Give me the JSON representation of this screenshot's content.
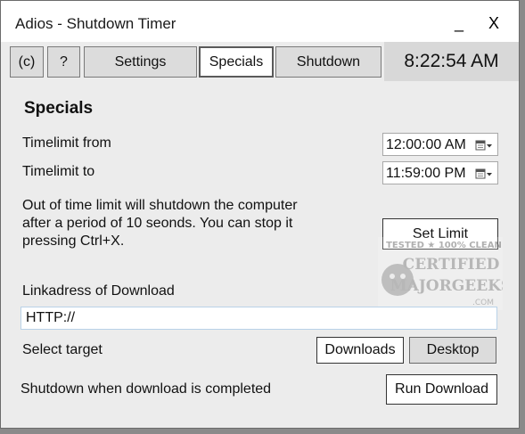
{
  "window": {
    "title": "Adios - Shutdown Timer"
  },
  "titlebar": {
    "minimize": "_",
    "close": "X"
  },
  "tabs": [
    {
      "label": "(c)"
    },
    {
      "label": "?"
    },
    {
      "label": "Settings"
    },
    {
      "label": "Specials",
      "active": true
    },
    {
      "label": "Shutdown"
    }
  ],
  "clock": "8:22:54 AM",
  "specials": {
    "heading": "Specials",
    "timelimit_from_label": "Timelimit from",
    "timelimit_from_value": "12:00:00 AM",
    "timelimit_to_label": "Timelimit to",
    "timelimit_to_value": "11:59:00 PM",
    "description": "Out of time limit will shutdown the computer after a period of 10 seonds. You can stop it pressing Ctrl+X.",
    "set_limit_button": "Set Limit",
    "link_label": "Linkadress of Download",
    "link_value": "HTTP://",
    "select_target_label": "Select target",
    "downloads_button": "Downloads",
    "desktop_button": "Desktop",
    "shutdown_label": "Shutdown when download is completed",
    "run_download_button": "Run Download"
  },
  "watermark": {
    "line1": "TESTED ★ 100% CLEAN",
    "line2": "CERTIFIED",
    "line3": "MAJORGEEKS",
    "line4": ".COM"
  },
  "colors": {
    "window_bg": "#ececec",
    "titlebar_bg": "#ffffff",
    "tab_bg": "#dcdcdc",
    "active_tab_bg": "#ffffff",
    "clock_bg": "#d8d8d8",
    "input_border": "#b9d2e8"
  }
}
